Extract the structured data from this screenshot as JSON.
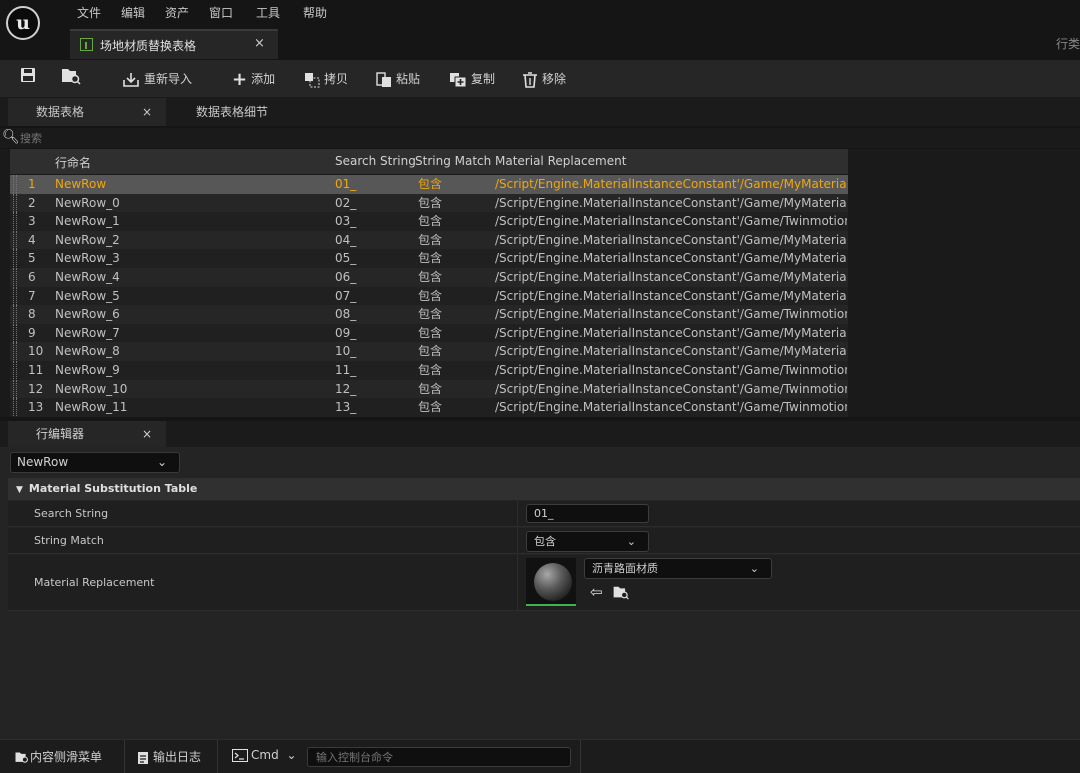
{
  "app": {
    "logo_text": "u"
  },
  "menu": [
    "文件",
    "编辑",
    "资产",
    "窗口",
    "工具",
    "帮助"
  ],
  "doc_tab": {
    "label": "场地材质替换表格",
    "close": "×"
  },
  "top_right_text": "行类",
  "toolbar": {
    "reimport": "重新导入",
    "add": "添加",
    "copy": "拷贝",
    "paste": "粘贴",
    "duplicate": "复制",
    "remove": "移除"
  },
  "panel_tabs": {
    "data_table": "数据表格",
    "close": "×",
    "details": "数据表格细节"
  },
  "search": {
    "placeholder": "搜索"
  },
  "table": {
    "headers": {
      "row_name": "行命名",
      "search": "Search String",
      "match": "String Match",
      "material": "Material Replacement"
    },
    "rows": [
      {
        "num": "1",
        "name": "NewRow",
        "search": "01_",
        "match": "包含",
        "material": "/Script/Engine.MaterialInstanceConstant'/Game/MyMaterial/沥青"
      },
      {
        "num": "2",
        "name": "NewRow_0",
        "search": "02_",
        "match": "包含",
        "material": "/Script/Engine.MaterialInstanceConstant'/Game/MyMaterial/草地"
      },
      {
        "num": "3",
        "name": "NewRow_1",
        "search": "03_",
        "match": "包含",
        "material": "/Script/Engine.MaterialInstanceConstant'/Game/TwinmotionMate"
      },
      {
        "num": "4",
        "name": "NewRow_2",
        "search": "04_",
        "match": "包含",
        "material": "/Script/Engine.MaterialInstanceConstant'/Game/MyMaterial/红砖"
      },
      {
        "num": "5",
        "name": "NewRow_3",
        "search": "05_",
        "match": "包含",
        "material": "/Script/Engine.MaterialInstanceConstant'/Game/MyMaterial/MI_N"
      },
      {
        "num": "6",
        "name": "NewRow_4",
        "search": "06_",
        "match": "包含",
        "material": "/Script/Engine.MaterialInstanceConstant'/Game/MyMaterial/木栏"
      },
      {
        "num": "7",
        "name": "NewRow_5",
        "search": "07_",
        "match": "包含",
        "material": "/Script/Engine.MaterialInstanceConstant'/Game/MyMaterial/铁栏"
      },
      {
        "num": "8",
        "name": "NewRow_6",
        "search": "08_",
        "match": "包含",
        "material": "/Script/Engine.MaterialInstanceConstant'/Game/TwinmotionMate"
      },
      {
        "num": "9",
        "name": "NewRow_7",
        "search": "09_",
        "match": "包含",
        "material": "/Script/Engine.MaterialInstanceConstant'/Game/MyMaterial/M_w"
      },
      {
        "num": "10",
        "name": "NewRow_8",
        "search": "10_",
        "match": "包含",
        "material": "/Script/Engine.MaterialInstanceConstant'/Game/MyMaterial/铁栅"
      },
      {
        "num": "11",
        "name": "NewRow_9",
        "search": "11_",
        "match": "包含",
        "material": "/Script/Engine.MaterialInstanceConstant'/Game/TwinmotionMate"
      },
      {
        "num": "12",
        "name": "NewRow_10",
        "search": "12_",
        "match": "包含",
        "material": "/Script/Engine.MaterialInstanceConstant'/Game/TwinmotionMate"
      },
      {
        "num": "13",
        "name": "NewRow_11",
        "search": "13_",
        "match": "包含",
        "material": "/Script/Engine.MaterialInstanceConstant'/Game/TwinmotionMate"
      }
    ]
  },
  "row_editor": {
    "tab": "行编辑器",
    "close": "×",
    "selected_row": "NewRow",
    "section": "Material Substitution Table",
    "search_label": "Search String",
    "search_value": "01_",
    "match_label": "String Match",
    "match_value": "包含",
    "material_label": "Material Replacement",
    "material_value": "沥青路面材质"
  },
  "bottom": {
    "content_drawer": "内容侧滑菜单",
    "output_log": "输出日志",
    "cmd": "Cmd",
    "cmd_placeholder": "输入控制台命令"
  },
  "colors": {
    "selected_text": "#f0a70e",
    "thumb_underline": "#3fb34f",
    "table_icon": "#67a844"
  }
}
